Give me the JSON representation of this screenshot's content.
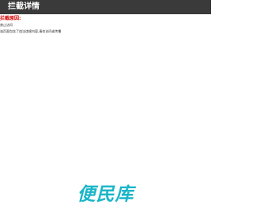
{
  "header": {
    "title": "拦截详情"
  },
  "block": {
    "reason_heading": "拦截原因:",
    "reason": "禁止访问",
    "detail": "该页面包含了违法违规内容,请勿访问或传播"
  },
  "footer": {
    "brand": "便民库"
  },
  "colors": {
    "header_bg": "#3a3a3a",
    "reason_red": "#d40000",
    "brand_cyan": "#1ab6c8"
  }
}
